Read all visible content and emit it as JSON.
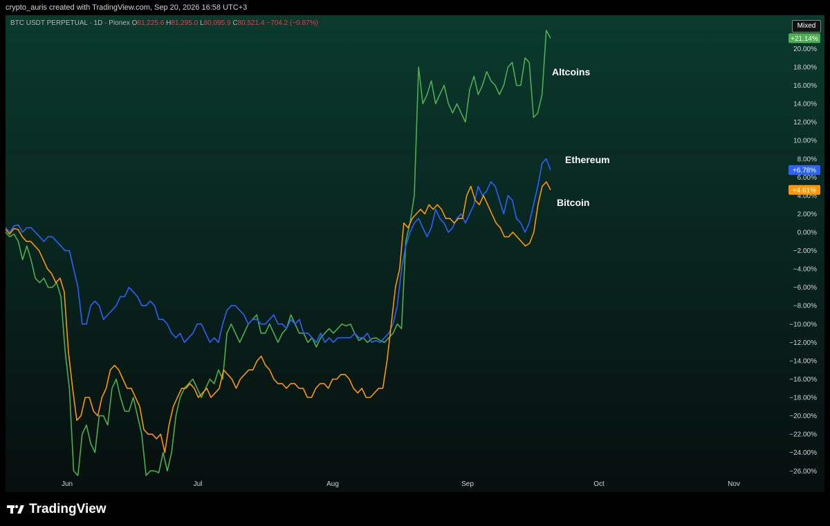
{
  "header": {
    "credit": "crypto_auris created with TradingView.com, Sep 20, 2026 16:58 UTC+3"
  },
  "legend": {
    "symbol": "BTC USDT PERPETUAL · 1D · Pionex",
    "open_label": "O",
    "open": "81,225.6",
    "high_label": "H",
    "high": "81,295.0",
    "low_label": "L",
    "low": "80,095.9",
    "close_label": "C",
    "close": "80,521.4",
    "change": "−704.2 (−0.87%)"
  },
  "scale_mode": "Mixed",
  "brand": "TradingView",
  "colors": {
    "altcoins": "#4caf50",
    "ethereum": "#2962ff",
    "bitcoin": "#ff9800",
    "text": "#d1d4dc",
    "negative": "#f23645"
  },
  "chart_data": {
    "type": "line",
    "x_ticks": [
      "Jun",
      "Jul",
      "Aug",
      "Sep",
      "Oct",
      "Nov"
    ],
    "ylim": [
      -27,
      22.5
    ],
    "y_ticks": [
      "20.00%",
      "18.00%",
      "16.00%",
      "14.00%",
      "12.00%",
      "10.00%",
      "8.00%",
      "6.00%",
      "4.00%",
      "2.00%",
      "0.00%",
      "−2.00%",
      "−4.00%",
      "−6.00%",
      "−8.00%",
      "−10.00%",
      "−12.00%",
      "−14.00%",
      "−16.00%",
      "−18.00%",
      "−20.00%",
      "−22.00%",
      "−24.00%",
      "−26.00%"
    ],
    "y_tick_values": [
      20,
      18,
      16,
      14,
      12,
      10,
      8,
      6,
      4,
      2,
      0,
      -2,
      -4,
      -6,
      -8,
      -10,
      -12,
      -14,
      -16,
      -18,
      -20,
      -22,
      -24,
      -26
    ],
    "grid": false,
    "series": [
      {
        "name": "Altcoins",
        "label": "+21.14%",
        "color": "#4caf50",
        "values": [
          0,
          -0.5,
          -0.2,
          -1,
          -3,
          -1.5,
          -3,
          -5,
          -5.5,
          -5,
          -6,
          -6,
          -5.5,
          -7,
          -13,
          -17,
          -26,
          -26.5,
          -22,
          -21,
          -23,
          -24,
          -20,
          -20,
          -21,
          -17,
          -16,
          -18,
          -19.5,
          -19.5,
          -18,
          -20,
          -22,
          -26.5,
          -26,
          -26,
          -26.2,
          -24,
          -26,
          -24,
          -20,
          -18,
          -17,
          -16.5,
          -16,
          -17,
          -18,
          -17,
          -16,
          -16.5,
          -15,
          -16,
          -11,
          -10,
          -11,
          -12,
          -11,
          -10,
          -9.5,
          -9,
          -11,
          -11,
          -10,
          -11,
          -12,
          -11,
          -10.5,
          -9,
          -10,
          -11,
          -11,
          -12,
          -11.5,
          -12.5,
          -11.5,
          -11,
          -10.5,
          -11,
          -10.5,
          -10,
          -10.2,
          -10,
          -11,
          -11.8,
          -11.5,
          -12,
          -11.6,
          -11.5,
          -11.8,
          -12,
          -11.5,
          -11,
          -10,
          -10.5,
          -1,
          1,
          4,
          18,
          14,
          15,
          16.5,
          14,
          15,
          16,
          14,
          13,
          14,
          13,
          12,
          15.5,
          17,
          15,
          16,
          17.5,
          16.5,
          16,
          15,
          16,
          18,
          18.5,
          16,
          16,
          19,
          18.5,
          12.5,
          13,
          15,
          22,
          21.14
        ]
      },
      {
        "name": "Ethereum",
        "label": "+6.78%",
        "color": "#2962ff",
        "values": [
          0.5,
          0,
          0.7,
          0.8,
          0,
          0.5,
          0.5,
          0,
          -0.5,
          -1,
          -0.5,
          -0.5,
          -1,
          -1.5,
          -2,
          -2,
          -4,
          -6,
          -10,
          -10,
          -8,
          -7.5,
          -8,
          -9.5,
          -9,
          -8.5,
          -8,
          -7,
          -7,
          -6,
          -6.5,
          -7,
          -8,
          -8,
          -7.5,
          -8,
          -9.5,
          -9.5,
          -10,
          -11,
          -11.5,
          -11,
          -12,
          -11.5,
          -11,
          -10,
          -10,
          -11,
          -12,
          -11.5,
          -12,
          -10,
          -8.5,
          -8,
          -8,
          -8.5,
          -9,
          -10,
          -9.5,
          -9.5,
          -10,
          -10,
          -9.5,
          -9,
          -10,
          -10,
          -10.5,
          -9.5,
          -10,
          -9.5,
          -11,
          -11,
          -11.5,
          -12,
          -11,
          -12,
          -11.5,
          -12,
          -11.5,
          -11.5,
          -11.5,
          -11.5,
          -11,
          -11.5,
          -11.5,
          -11,
          -12,
          -11.8,
          -12,
          -11.5,
          -11,
          -10,
          -8,
          -4,
          -1.5,
          0,
          1,
          1.5,
          0.5,
          -0.5,
          0.5,
          2.5,
          1.5,
          1,
          0,
          0.5,
          1.5,
          2,
          1,
          2,
          3,
          5,
          4,
          4.5,
          5.5,
          5,
          3.5,
          2,
          4,
          3.5,
          1.5,
          1,
          0,
          1,
          3,
          5,
          7.5,
          8,
          6.78
        ]
      },
      {
        "name": "Bitcoin",
        "label": "+4.61%",
        "color": "#ff9800",
        "values": [
          0.3,
          -0.2,
          0.4,
          0.3,
          -0.5,
          -1,
          -1,
          -1.5,
          -2,
          -3,
          -4,
          -4.5,
          -5.5,
          -5,
          -6.5,
          -13,
          -17,
          -20.5,
          -20,
          -18,
          -18,
          -19.5,
          -20,
          -18,
          -17,
          -15,
          -14.5,
          -15,
          -16,
          -17,
          -17,
          -18,
          -19,
          -21.5,
          -22,
          -22,
          -22.5,
          -22,
          -24,
          -21,
          -19,
          -18,
          -17,
          -17,
          -16.5,
          -17,
          -18,
          -17.5,
          -17,
          -18,
          -17.5,
          -17,
          -15,
          -15.5,
          -16,
          -17,
          -16,
          -15.5,
          -15,
          -15,
          -14,
          -13.5,
          -14.5,
          -15,
          -16,
          -16.5,
          -16.5,
          -17,
          -16.5,
          -16.5,
          -17,
          -17,
          -18,
          -18,
          -17,
          -16.5,
          -16.5,
          -17,
          -16,
          -16,
          -15.5,
          -15.5,
          -16,
          -17,
          -17.5,
          -17,
          -18,
          -18,
          -17.5,
          -17,
          -17,
          -14,
          -10,
          -6,
          -4,
          1,
          0.5,
          1.5,
          2,
          2.5,
          2,
          3,
          2.5,
          3,
          2.5,
          1.5,
          1.5,
          1,
          1.5,
          1.5,
          4,
          5,
          3.5,
          3,
          4,
          3,
          2,
          1,
          0.5,
          -0.5,
          -0.5,
          0,
          -0.5,
          -1,
          -1.5,
          -1.2,
          0,
          3,
          5,
          5.5,
          4.61
        ]
      }
    ],
    "annotations": [
      "Altcoins",
      "Ethereum",
      "Bitcoin"
    ]
  }
}
